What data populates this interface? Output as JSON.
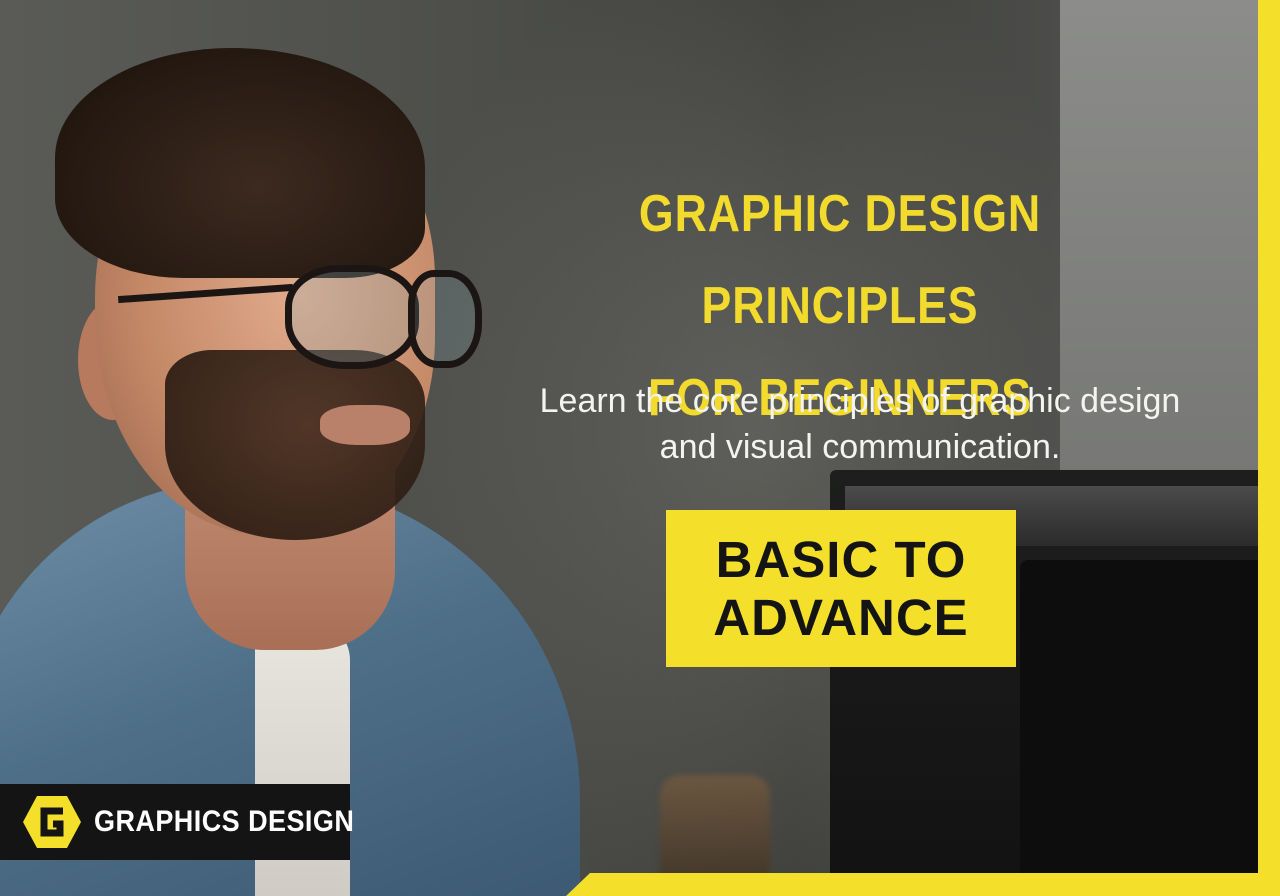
{
  "headline": {
    "line1": "GRAPHIC DESIGN PRINCIPLES",
    "line2": "FOR BEGINNERS"
  },
  "subtitle": {
    "line1": "Learn the core principles of graphic design",
    "line2": "and visual communication."
  },
  "badge": {
    "line1": "BASIC TO",
    "line2": "ADVANCE"
  },
  "brand": {
    "logo_icon": "hexagon-g-logo-icon",
    "name": "GRAPHICS DESIGN"
  },
  "colors": {
    "accent_yellow": "#f4e02a",
    "headline_yellow": "#f2db2c",
    "dark": "#141414",
    "white": "#ffffff"
  }
}
